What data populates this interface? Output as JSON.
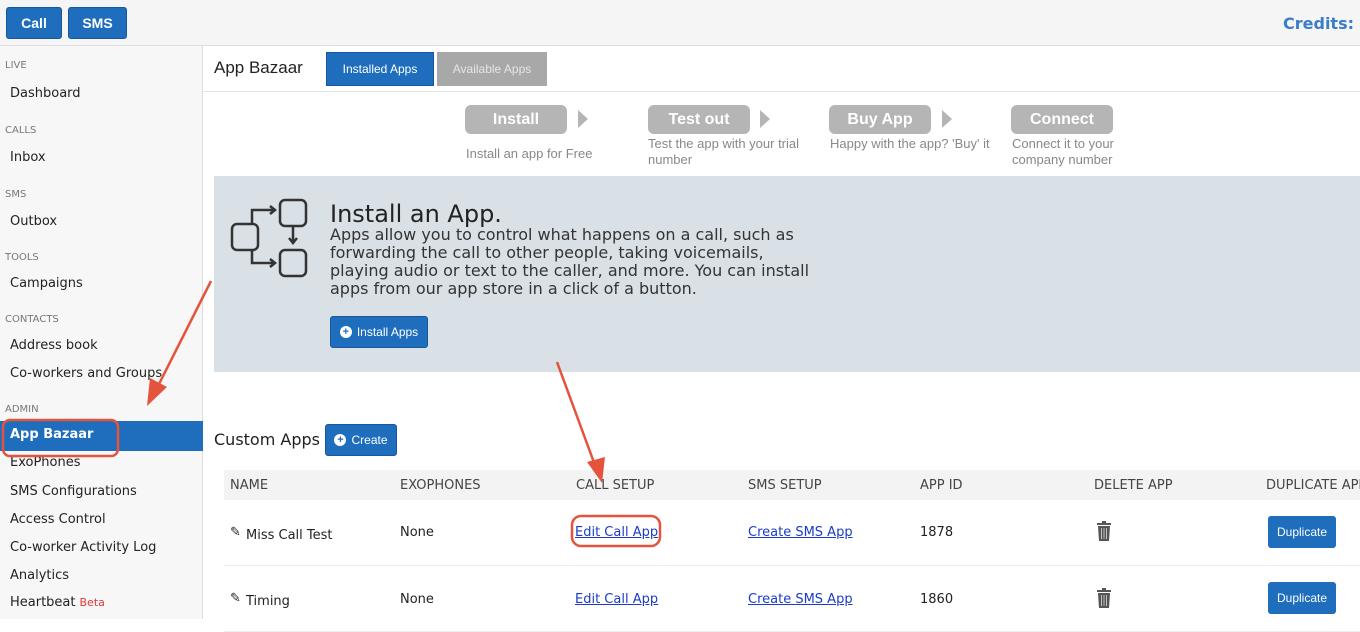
{
  "topbar": {
    "call_label": "Call",
    "sms_label": "SMS",
    "credits_label": "Credits:"
  },
  "sidebar": {
    "sections": [
      {
        "title": "LIVE",
        "items": [
          "Dashboard"
        ]
      },
      {
        "title": "CALLS",
        "items": [
          "Inbox"
        ]
      },
      {
        "title": "SMS",
        "items": [
          "Outbox"
        ]
      },
      {
        "title": "TOOLS",
        "items": [
          "Campaigns"
        ]
      },
      {
        "title": "CONTACTS",
        "items": [
          "Address book",
          "Co-workers and Groups"
        ]
      },
      {
        "title": "ADMIN",
        "items": [
          "App Bazaar",
          "ExoPhones",
          "SMS Configurations",
          "Access Control",
          "Co-worker Activity Log",
          "Analytics",
          "Heartbeat"
        ]
      }
    ],
    "active": "App Bazaar",
    "heartbeat_badge": "Beta"
  },
  "header": {
    "title": "App Bazaar",
    "tabs": [
      "Installed Apps",
      "Available Apps"
    ],
    "active_tab": "Installed Apps"
  },
  "steps": [
    {
      "label": "Install",
      "desc": "Install an app for Free"
    },
    {
      "label": "Test out",
      "desc": "Test the app with your trial number"
    },
    {
      "label": "Buy App",
      "desc": "Happy with the app? 'Buy' it"
    },
    {
      "label": "Connect",
      "desc": "Connect it to your company number"
    }
  ],
  "banner": {
    "title": "Install an App.",
    "text": "Apps allow you to control what happens on a call, such as forwarding the call to other people, taking voicemails, playing audio or text to the caller, and more. You can install apps from our app store in a click of a button.",
    "button_label": "Install Apps"
  },
  "custom_apps": {
    "title": "Custom Apps",
    "create_label": "Create",
    "columns": [
      "NAME",
      "EXOPHONES",
      "CALL SETUP",
      "SMS SETUP",
      "APP ID",
      "DELETE APP",
      "DUPLICATE APP"
    ],
    "rows": [
      {
        "name": "Miss Call Test",
        "exophones": "None",
        "call_setup": "Edit Call App",
        "sms_setup": "Create SMS App",
        "app_id": "1878",
        "duplicate": "Duplicate"
      },
      {
        "name": "Timing",
        "exophones": "None",
        "call_setup": "Edit Call App",
        "sms_setup": "Create SMS App",
        "app_id": "1860",
        "duplicate": "Duplicate"
      }
    ]
  },
  "colors": {
    "accent": "#1f6ebd",
    "annotation": "#e5533d",
    "banner_bg": "#d9e1e6"
  }
}
